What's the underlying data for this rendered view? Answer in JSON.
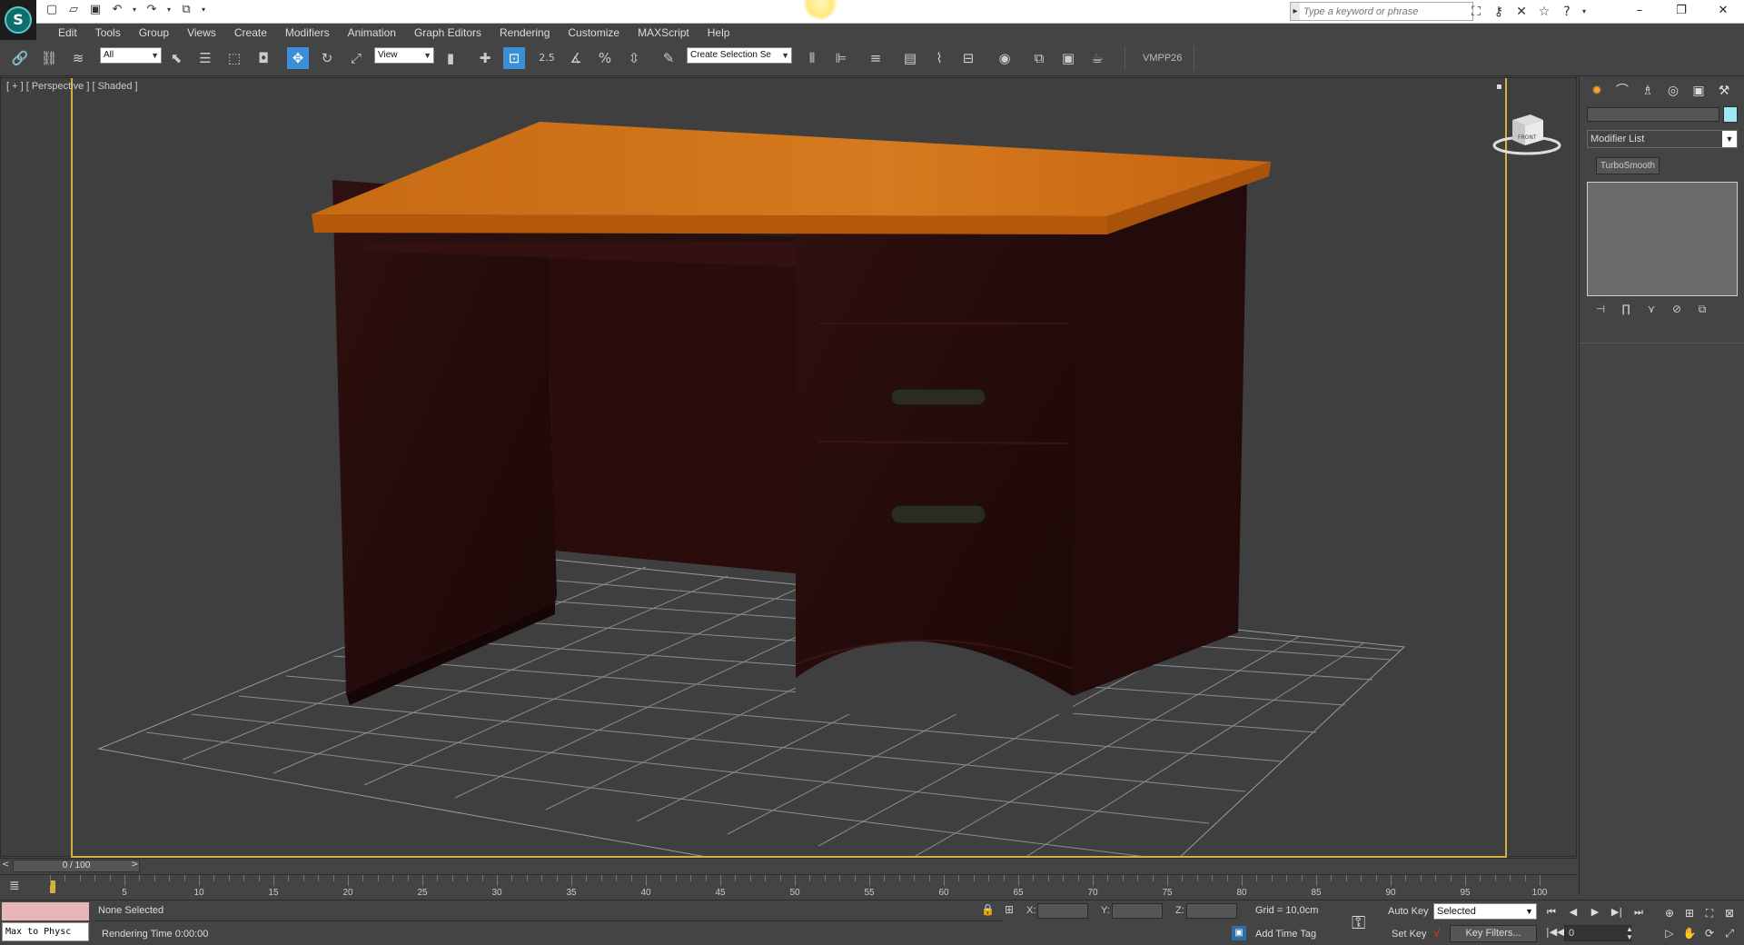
{
  "title_bar": {
    "search_placeholder": "Type a keyword or phrase"
  },
  "menu": [
    "Edit",
    "Tools",
    "Group",
    "Views",
    "Create",
    "Modifiers",
    "Animation",
    "Graph Editors",
    "Rendering",
    "Customize",
    "MAXScript",
    "Help"
  ],
  "toolbar": {
    "selection_filter": "All",
    "ref_coord": "View",
    "snap_label": "2.5",
    "named_selection_placeholder": "Create Selection Se",
    "workspace_label": "VMPP26"
  },
  "viewport": {
    "label": "[ + ] [ Perspective ] [ Shaded ]",
    "viewcube_label": "FRONT",
    "colors": {
      "frame_border": "#d3b33a",
      "desk_top": "#cc6b10",
      "desk_body": "#2a0e0e",
      "grid": "#8c8c8c"
    }
  },
  "command_panel": {
    "modifier_list": "Modifier List",
    "modifier_button": "TurboSmooth",
    "color_swatch": "#9ee7f4"
  },
  "time_slider": {
    "position": "0 / 100"
  },
  "track_bar": {
    "labels": [
      "5",
      "10",
      "15",
      "20",
      "25",
      "30",
      "35",
      "40",
      "45",
      "50",
      "55",
      "60",
      "65",
      "70",
      "75",
      "80",
      "85",
      "90",
      "95",
      "100"
    ]
  },
  "status_bar": {
    "maxscript_text": "Max to Physc",
    "selection_status": "None Selected",
    "rendering_time": "Rendering Time  0:00:00",
    "x_label": "X:",
    "y_label": "Y:",
    "z_label": "Z:",
    "grid": "Grid = 10,0cm",
    "add_time_tag": "Add Time Tag",
    "auto_key": "Auto Key",
    "set_key": "Set Key",
    "key_mode": "Selected",
    "key_filters": "Key Filters...",
    "current_frame": "0"
  }
}
